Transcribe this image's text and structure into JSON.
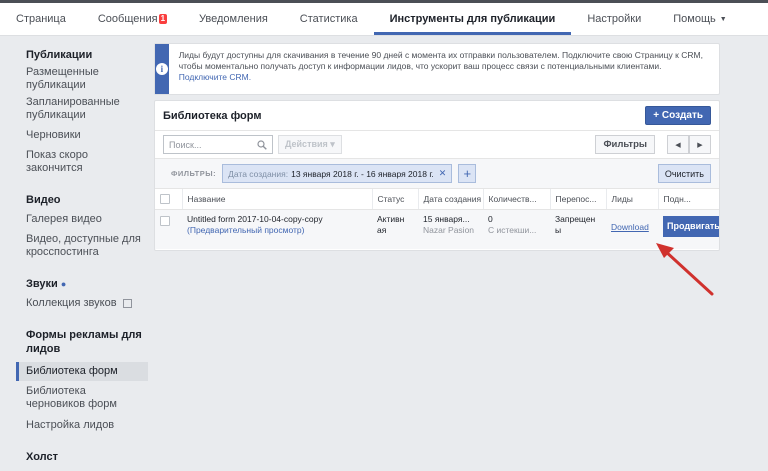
{
  "topnav": {
    "tabs": [
      "Страница",
      "Сообщения",
      "Уведомления",
      "Статистика",
      "Инструменты для публикации"
    ],
    "messages_badge": "1",
    "right": [
      "Настройки",
      "Помощь"
    ]
  },
  "sidebar": {
    "publications": {
      "title": "Публикации",
      "items": [
        "Размещенные публикации",
        "Запланированные публикации",
        "Черновики",
        "Показ скоро закончится"
      ]
    },
    "video": {
      "title": "Видео",
      "items": [
        "Галерея видео",
        "Видео, доступные для кросспостинга"
      ]
    },
    "sounds": {
      "title": "Звуки",
      "items": [
        "Коллекция звуков"
      ]
    },
    "lead_forms": {
      "title": "Формы рекламы для лидов",
      "items": [
        "Библиотека форм",
        "Библиотека черновиков форм",
        "Настройка лидов"
      ]
    },
    "canvas": {
      "title": "Холст"
    }
  },
  "banner": {
    "text": "Лиды будут доступны для скачивания в течение 90 дней с момента их отправки пользователем. Подключите свою Страницу к CRM, чтобы моментально получать доступ к информации лидов, что ускорит ваш процесс связи с потенциальными клиентами.",
    "link": "Подключите CRM."
  },
  "library": {
    "title": "Библиотека форм",
    "create_label": "+ Создать",
    "search_placeholder": "Поиск...",
    "actions_label": "Действия ▾",
    "filters_label": "Фильтры",
    "filters_caption": "ФИЛЬТРЫ:",
    "filter_chip": {
      "key": "Дата создания:",
      "value": "13 января 2018 г. - 16 января 2018 г."
    },
    "clear_label": "Очистить",
    "columns": [
      "Название",
      "Статус",
      "Дата создания",
      "Количеств...",
      "Перепос...",
      "Лиды",
      "Подн..."
    ],
    "row": {
      "name": "Untitled form 2017-10-04-copy-copy",
      "preview": "(Предварительный просмотр)",
      "status": "Активн ая",
      "date": "15 января...",
      "author": "Nazar Pasion",
      "count": "0",
      "count_sub": "С истекши...",
      "repost": "Запрещен ы",
      "leads": "Download",
      "promote": "Продвигать"
    }
  },
  "colors": {
    "accent": "#4267b2",
    "arrow": "#d0312d"
  }
}
